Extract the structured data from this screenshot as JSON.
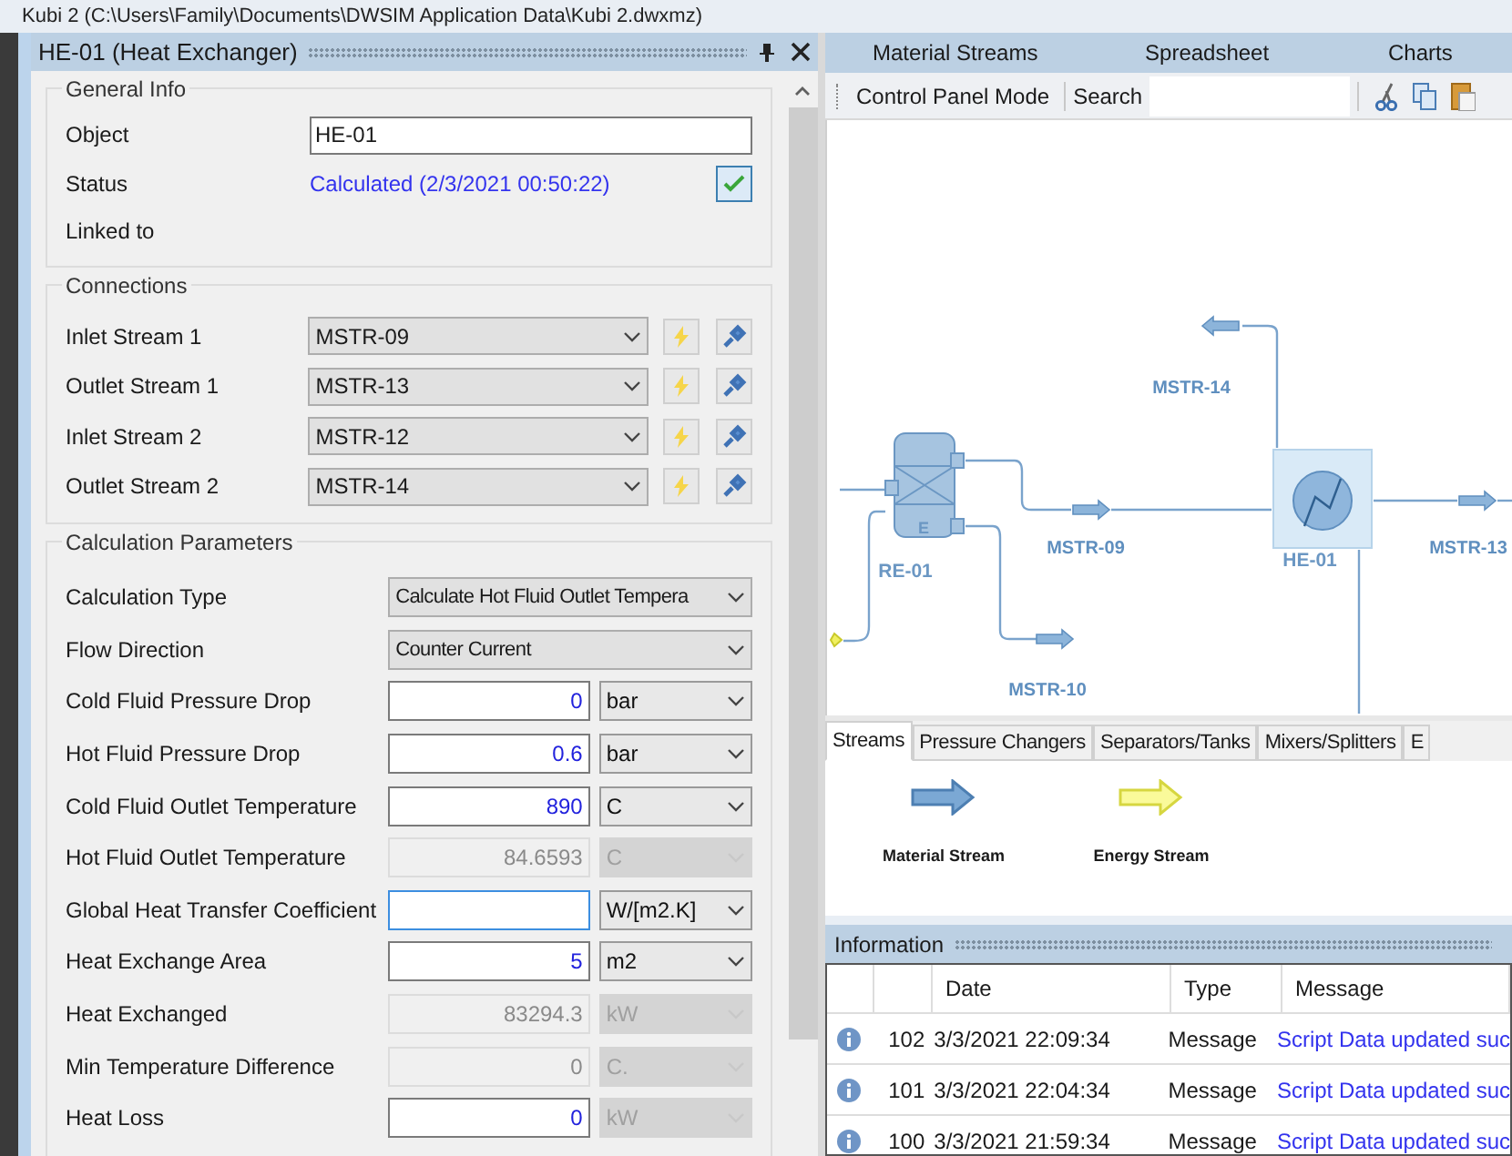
{
  "window": {
    "title": "Kubi 2 (C:\\Users\\Family\\Documents\\DWSIM Application Data\\Kubi 2.dwxmz)"
  },
  "panel": {
    "title": "HE-01 (Heat Exchanger)",
    "general_info": {
      "title": "General Info",
      "object_label": "Object",
      "object_value": "HE-01",
      "status_label": "Status",
      "status_value": "Calculated (2/3/2021 00:50:22)",
      "linked_label": "Linked to"
    },
    "connections": {
      "title": "Connections",
      "rows": [
        {
          "label": "Inlet Stream 1",
          "value": "MSTR-09"
        },
        {
          "label": "Outlet Stream 1",
          "value": "MSTR-13"
        },
        {
          "label": "Inlet Stream 2",
          "value": "MSTR-12"
        },
        {
          "label": "Outlet Stream 2",
          "value": "MSTR-14"
        }
      ]
    },
    "calculation": {
      "title": "Calculation Parameters",
      "rows": [
        {
          "kind": "select",
          "label": "Calculation Type",
          "value": "Calculate Hot Fluid Outlet Tempera"
        },
        {
          "kind": "select",
          "label": "Flow Direction",
          "value": "Counter Current"
        },
        {
          "kind": "number",
          "label": "Cold Fluid Pressure Drop",
          "value": "0",
          "unit": "bar",
          "disabled": false,
          "focused": false,
          "unit_disabled": false
        },
        {
          "kind": "number",
          "label": "Hot Fluid Pressure Drop",
          "value": "0.6",
          "unit": "bar",
          "disabled": false,
          "focused": false,
          "unit_disabled": false
        },
        {
          "kind": "number",
          "label": "Cold Fluid Outlet Temperature",
          "value": "890",
          "unit": "C",
          "disabled": false,
          "focused": false,
          "unit_disabled": false
        },
        {
          "kind": "number",
          "label": "Hot Fluid Outlet Temperature",
          "value": "84.6593",
          "unit": "C",
          "disabled": true,
          "focused": false,
          "unit_disabled": true
        },
        {
          "kind": "number",
          "label": "Global Heat Transfer Coefficient",
          "unit": "W/[m2.K]",
          "disabled": false,
          "focused": true,
          "unit_disabled": false
        },
        {
          "kind": "number",
          "label": "Heat Exchange Area",
          "value": "5",
          "unit": "m2",
          "disabled": false,
          "focused": false,
          "unit_disabled": false
        },
        {
          "kind": "number",
          "label": "Heat Exchanged",
          "value": "83294.3",
          "unit": "kW",
          "disabled": true,
          "focused": false,
          "unit_disabled": true
        },
        {
          "kind": "number",
          "label": "Min Temperature Difference",
          "value": "0",
          "unit": "C.",
          "disabled": true,
          "focused": false,
          "unit_disabled": true
        },
        {
          "kind": "number",
          "label": "Heat Loss",
          "value": "0",
          "unit": "kW",
          "disabled": false,
          "focused": false,
          "unit_disabled": true
        }
      ]
    }
  },
  "document_tabs": [
    "Material Streams",
    "Spreadsheet",
    "Charts"
  ],
  "toolbar": {
    "mode": "Control Panel Mode",
    "search": "Search"
  },
  "flowsheet": {
    "labels": [
      {
        "kind": "stream",
        "text": "MSTR-14"
      },
      {
        "kind": "unit",
        "text": "RE-01"
      },
      {
        "kind": "stream",
        "text": "MSTR-09"
      },
      {
        "kind": "unit",
        "text": "HE-01"
      },
      {
        "kind": "stream",
        "text": "MSTR-13"
      },
      {
        "kind": "stream",
        "text": "MSTR-10"
      }
    ],
    "reactor_letter": "E"
  },
  "palette": {
    "tabs": [
      {
        "label": "Streams",
        "selected": true
      },
      {
        "label": "Pressure Changers",
        "selected": false
      },
      {
        "label": "Separators/Tanks",
        "selected": false
      },
      {
        "label": "Mixers/Splitters",
        "selected": false
      },
      {
        "label": "E",
        "selected": false
      }
    ],
    "items": [
      {
        "kind": "material",
        "label": "Material Stream"
      },
      {
        "kind": "energy",
        "label": "Energy Stream"
      }
    ]
  },
  "information": {
    "title": "Information",
    "columns": [
      "Date",
      "Type",
      "Message"
    ],
    "rows": [
      {
        "number": "102",
        "date": "3/3/2021 22:09:34",
        "type": "Message",
        "message": "Script Data updated suc"
      },
      {
        "number": "101",
        "date": "3/3/2021 22:04:34",
        "type": "Message",
        "message": "Script Data updated suc"
      },
      {
        "number": "100",
        "date": "3/3/2021 21:59:34",
        "type": "Message",
        "message": "Script Data updated suc"
      }
    ]
  }
}
